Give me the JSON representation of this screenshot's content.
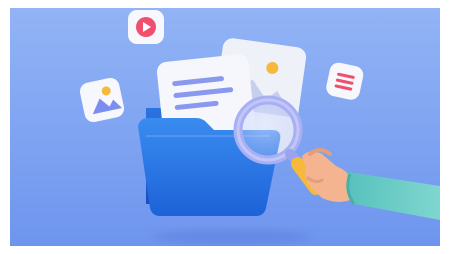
{
  "scene": {
    "description_free": true,
    "objects": [
      {
        "name": "blue-folder",
        "kind": "folder"
      },
      {
        "name": "document-with-lines",
        "kind": "document"
      },
      {
        "name": "image-file-card",
        "kind": "image-file"
      },
      {
        "name": "magnifying-glass",
        "kind": "search-tool"
      },
      {
        "name": "hand",
        "kind": "hand"
      }
    ],
    "floating_icons": [
      {
        "name": "video-play-icon",
        "color": "#f0506e"
      },
      {
        "name": "image-gallery-icon",
        "color": "#7b8df0"
      },
      {
        "name": "text-lines-icon",
        "color": "#f0506e"
      }
    ]
  },
  "colors": {
    "background_top": "#8fb2f4",
    "background_bottom": "#6f97ef",
    "folder_front": "#2d7ee8",
    "folder_back": "#1f5fd2",
    "paper": "#f4f6fb",
    "doc_lines": "#8a99ef",
    "magnifier_ring": "#a9b1f4",
    "handle": "#f6b93b",
    "sleeve": "#5fc7c0",
    "skin": "#f3b48f",
    "accent_red": "#f0506e"
  }
}
